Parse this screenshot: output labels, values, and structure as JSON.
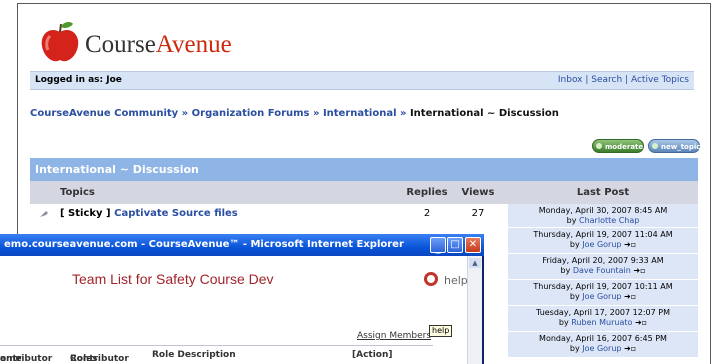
{
  "brand": {
    "part1": "Course",
    "part2": "Avenue"
  },
  "login": {
    "label": "Logged in as: Joe"
  },
  "toplinks": [
    "Inbox",
    "Search",
    "Active Topics"
  ],
  "breadcrumb": {
    "items": [
      "CourseAvenue Community",
      "Organization Forums",
      "International"
    ],
    "current": "International ~ Discussion",
    "sep": " » "
  },
  "buttons": {
    "moderate": "moderate",
    "new_topic": "new_topic"
  },
  "forum": {
    "title": "International ~ Discussion",
    "columns": {
      "topics": "Topics",
      "replies": "Replies",
      "views": "Views",
      "last_post": "Last Post"
    },
    "rows": [
      {
        "sticky": "[ Sticky ]",
        "topic": "Captivate Source files",
        "replies": "2",
        "views": "27",
        "date": "Monday, April 30, 2007 8:45 AM",
        "by": "by",
        "author": "Charlotte Chap"
      }
    ],
    "last_posts": [
      {
        "date": "Thursday, April 19, 2007 11:04 AM",
        "by": "by",
        "author": "Joe Gorup"
      },
      {
        "date": "Friday, April 20, 2007 9:33 AM",
        "by": "by",
        "author": "Dave Fountain"
      },
      {
        "date": "Thursday, April 19, 2007 10:11 AM",
        "by": "by",
        "author": "Joe Gorup"
      },
      {
        "date": "Tuesday, April 17, 2007 12:07 PM",
        "by": "by",
        "author": "Ruben Muruato"
      },
      {
        "date": "Monday, April 16, 2007 6:45 PM",
        "by": "by",
        "author": "Joe Gorup"
      }
    ]
  },
  "popup": {
    "window_title": "emo.courseavenue.com - CourseAvenue™ - Microsoft Internet Explorer",
    "team_title": "Team List for Safety Course Dev",
    "help": "help",
    "help_tooltip": "help",
    "assign_members": "Assign Members",
    "columns": {
      "contributor_name": "ontributor\name",
      "contributor_roles": "Contributor\nRoles",
      "role_description": "Role Description",
      "action": "[Action]"
    },
    "col1_line1": "ontributor",
    "col1_line2": "ame",
    "col2_line1": "Contributor",
    "col2_line2": "Roles"
  },
  "colors": {
    "link": "#2a4ea0",
    "header_blue": "#8fb4e6",
    "apple_red": "#cc2a0e",
    "team_title": "#a0242b"
  }
}
